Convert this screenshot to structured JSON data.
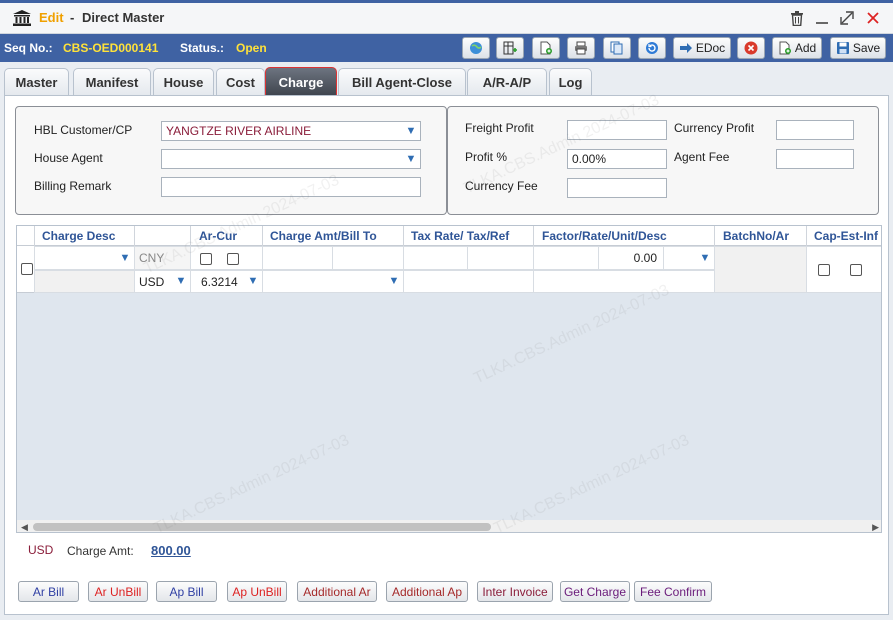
{
  "window": {
    "title_mode": "Edit",
    "title_sep": "-",
    "title_name": "Direct Master"
  },
  "status_bar": {
    "seq_label": "Seq No.:",
    "seq_value": "CBS-OED000141",
    "status_label": "Status.:",
    "status_value": "Open",
    "edoc_label": "EDoc",
    "add_label": "Add",
    "save_label": "Save"
  },
  "tabs": [
    "Master",
    "Manifest",
    "House",
    "Cost",
    "Charge",
    "Bill Agent-Close",
    "A/R-A/P",
    "Log"
  ],
  "active_tab": "Charge",
  "left_form": {
    "hbl_customer_label": "HBL Customer/CP",
    "hbl_customer_value": "YANGTZE RIVER AIRLINE",
    "house_agent_label": "House Agent",
    "house_agent_value": "",
    "billing_remark_label": "Billing Remark",
    "billing_remark_value": ""
  },
  "right_form": {
    "freight_profit_label": "Freight Profit",
    "freight_profit_value": "",
    "currency_profit_label": "Currency Profit",
    "currency_profit_value": "",
    "profit_pct_label": "Profit %",
    "profit_pct_value": "0.00%",
    "agent_fee_label": "Agent Fee",
    "agent_fee_value": "",
    "currency_fee_label": "Currency Fee",
    "currency_fee_value": ""
  },
  "grid": {
    "headers": [
      "Charge Desc",
      "Ar-Cur",
      "Charge Amt/Bill To",
      "Tax Rate/ Tax/Ref",
      "Factor/Rate/Unit/Desc",
      "BatchNo/Ar",
      "Cap-Est-Inf"
    ],
    "row": {
      "cur1": "CNY",
      "cur2": "USD",
      "rate": "6.3214",
      "factor": "0.00"
    }
  },
  "summary": {
    "currency": "USD",
    "charge_amt_label": "Charge Amt:",
    "charge_amt_value": "800.00"
  },
  "bottom_buttons": [
    "Ar Bill",
    "Ar UnBill",
    "Ap Bill",
    "Ap UnBill",
    "Additional Ar",
    "Additional Ap",
    "Inter Invoice",
    "Get Charge",
    "Fee Confirm"
  ],
  "watermark": "TLKA.CBS.Admin 2024-07-03",
  "colors": {
    "accent_blue": "#3f62a3",
    "title_edit": "#f0a000",
    "status_value": "#ffe23a",
    "header_text": "#2f5597"
  }
}
